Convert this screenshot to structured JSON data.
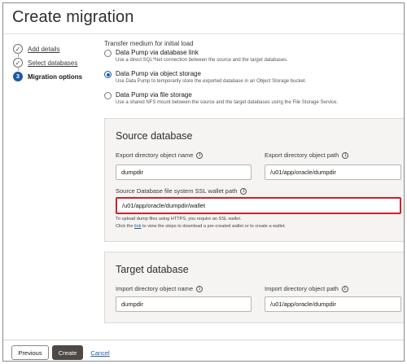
{
  "page": {
    "title": "Create migration"
  },
  "steps": [
    {
      "label": "Add details",
      "state": "done",
      "marker": "✓"
    },
    {
      "label": "Select databases",
      "state": "done",
      "marker": "✓"
    },
    {
      "label": "Migration options",
      "state": "current",
      "marker": "3"
    }
  ],
  "transfer": {
    "label": "Transfer medium for initial load",
    "options": [
      {
        "label": "Data Pump via database link",
        "desc": "Use a direct SQL*Net connection between the source and the target databases.",
        "checked": false
      },
      {
        "label": "Data Pump via object storage",
        "desc": "Use Data Pump to temporarily store the exported database in an Object Storage bucket.",
        "checked": true
      },
      {
        "label": "Data Pump via file storage",
        "desc": "Use a shared NFS mount between the source and the target databases using the File Storage Service.",
        "checked": false
      }
    ]
  },
  "source": {
    "title": "Source database",
    "export_dir_name_label": "Export directory object name",
    "export_dir_name_value": "dumpdir",
    "export_dir_path_label": "Export directory object path",
    "export_dir_path_value": "/u01/app/oracle/dumpdir",
    "wallet_label": "Source Database file system SSL wallet path",
    "wallet_value": "/u01/app/oracle/dumpdir/wallet",
    "hint_line1": "To upload dump files using HTTPS, you require an SSL wallet.",
    "hint_line2_pre": "Click the ",
    "hint_link": "link",
    "hint_line2_post": " to view the steps to download a pre-created wallet or to create a wallet."
  },
  "target": {
    "title": "Target database",
    "import_dir_name_label": "Import directory object name",
    "import_dir_name_value": "dumpdir",
    "import_dir_path_label": "Import directory object path",
    "import_dir_path_value": "/u01/app/oracle/dumpdir"
  },
  "footer": {
    "previous_label": "Previous",
    "create_label": "Create",
    "cancel_label": "Cancel"
  },
  "colors": {
    "accent": "#1b5aa3",
    "highlight": "#c9232d",
    "primary_button": "#4e4947"
  },
  "icons": {
    "info": "info-circle-icon",
    "done": "check-circle-icon",
    "current": "step-number-icon"
  }
}
